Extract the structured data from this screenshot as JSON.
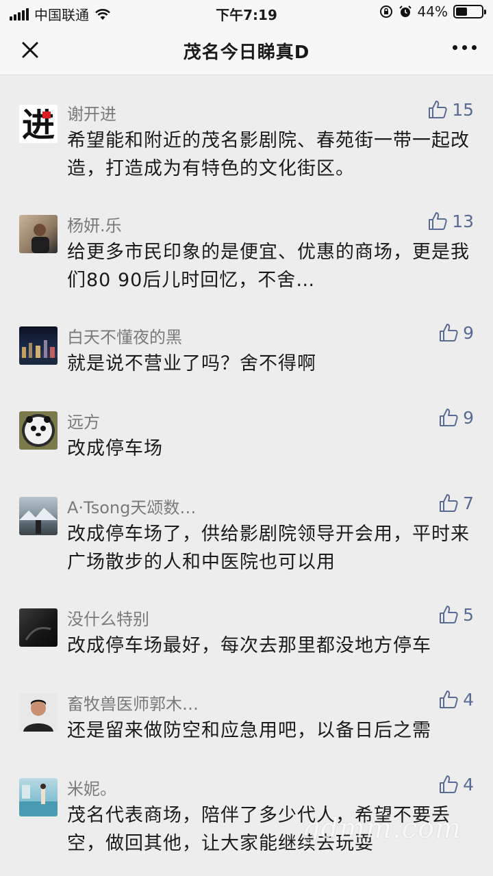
{
  "status_bar": {
    "carrier": "中国联通",
    "time": "下午7:19",
    "battery": "44%",
    "battery_level": 0.44,
    "icons": [
      "signal-icon",
      "wifi-icon",
      "rotation-lock-icon",
      "alarm-icon",
      "battery-icon"
    ]
  },
  "nav": {
    "title": "茂名今日睇真D",
    "icons": [
      "close-icon",
      "more-icon"
    ]
  },
  "comments": [
    {
      "name": "谢开进",
      "likes": "15",
      "text": "希望能和附近的茂名影剧院、春苑街一带一起改造，打造成为有特色的文化街区。",
      "avatar": "calligraphy-avatar"
    },
    {
      "name": "杨妍.乐",
      "likes": "13",
      "text": "给更多市民印象的是便宜、优惠的商场，更是我们80 90后儿时回忆，不舍…",
      "avatar": "person-photo-avatar"
    },
    {
      "name": "白天不懂夜的黑",
      "likes": "9",
      "text": "就是说不营业了吗？舍不得啊",
      "avatar": "night-city-avatar"
    },
    {
      "name": "远方",
      "likes": "9",
      "text": "改成停车场",
      "avatar": "panda-badge-avatar"
    },
    {
      "name": "A·Tsong天颂数…",
      "likes": "7",
      "text": "改成停车场了，供给影剧院领导开会用，平时来广场散步的人和中医院也可以用",
      "avatar": "landscape-avatar"
    },
    {
      "name": "没什么特别",
      "likes": "5",
      "text": "改成停车场最好，每次去那里都没地方停车",
      "avatar": "dark-photo-avatar"
    },
    {
      "name": "畜牧兽医师郭木…",
      "likes": "4",
      "text": "还是留来做防空和应急用吧，以备日后之需",
      "avatar": "portrait-avatar"
    },
    {
      "name": "米妮。",
      "likes": "4",
      "text": "茂名代表商场，陪伴了多少代人，希望不要丢空，做回其他，让大家能继续去玩耍",
      "avatar": "poolside-avatar"
    }
  ],
  "watermark": "gdmm.com",
  "colors": {
    "like": "#576b95",
    "name": "#7a7a7a",
    "background": "#ededed"
  }
}
